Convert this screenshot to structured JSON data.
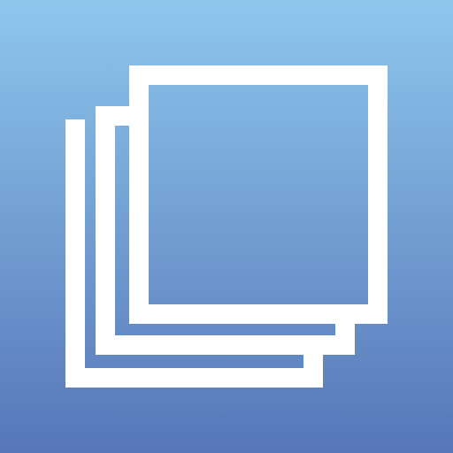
{
  "icon": {
    "name": "stacked-pages-icon",
    "layers": 3
  },
  "colors": {
    "gradient_top": "#8ec7ed",
    "gradient_bottom": "#5676b8",
    "stroke": "#ffffff"
  }
}
